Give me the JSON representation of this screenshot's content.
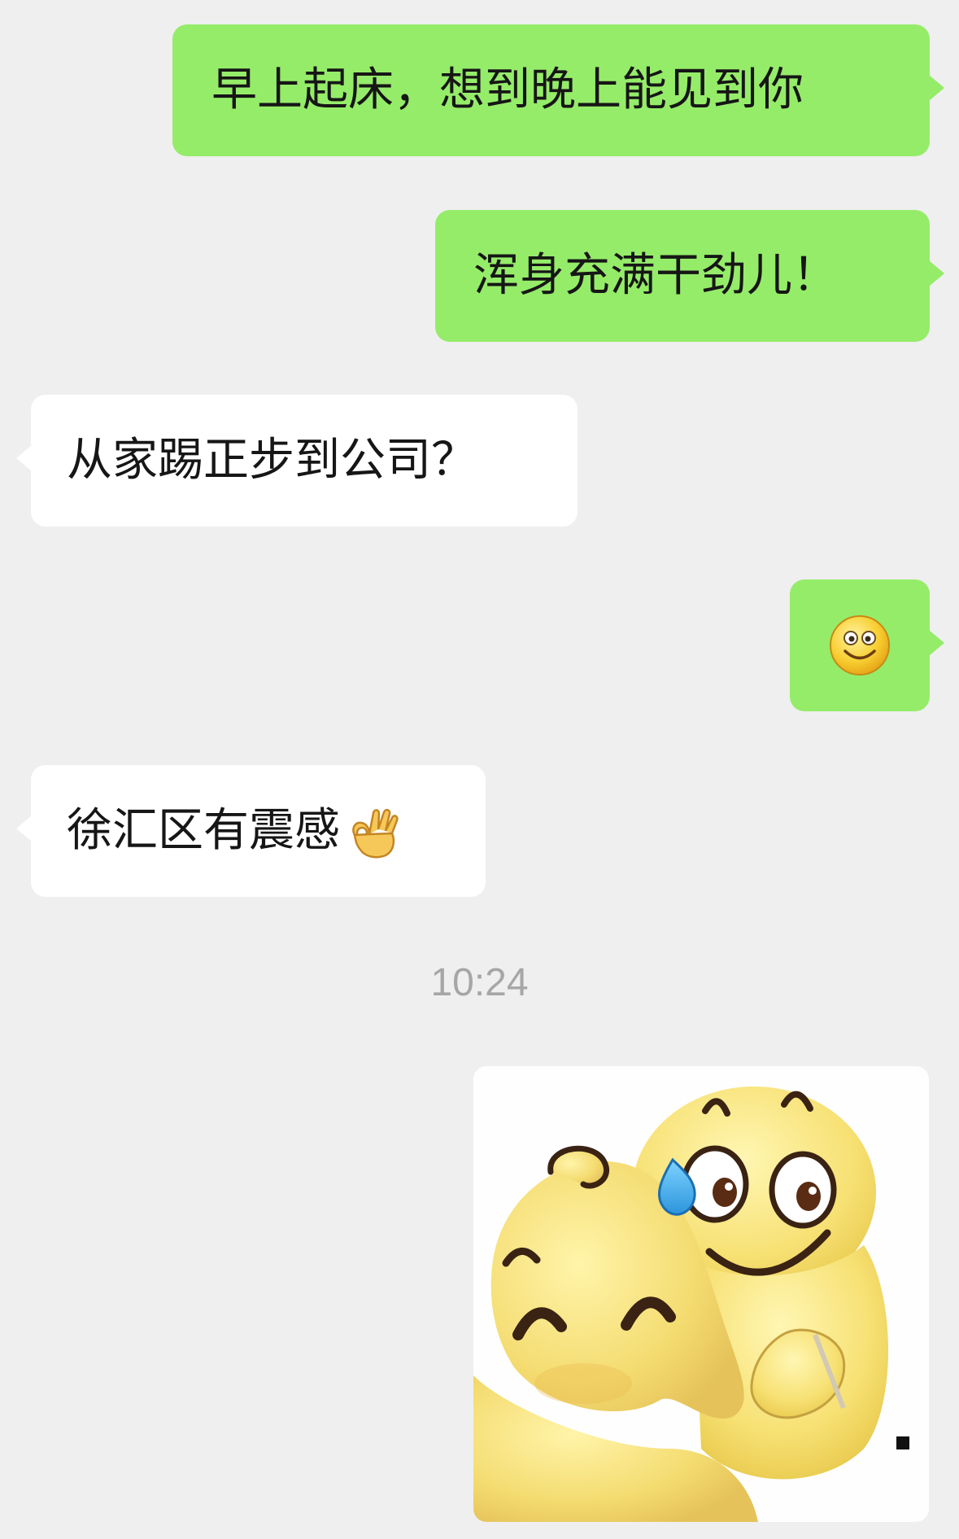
{
  "messages": [
    {
      "side": "sent",
      "text": "早上起床，想到晚上能见到你"
    },
    {
      "side": "sent",
      "text": "浑身充满干劲儿！"
    },
    {
      "side": "received",
      "text": "从家踢正步到公司？"
    },
    {
      "side": "sent",
      "emoji": "smile-emoji"
    },
    {
      "side": "received",
      "text": "徐汇区有震感",
      "emoji": "ok-hand-emoji"
    },
    {
      "side": "sent",
      "sticker": "hugging-emoji-sticker"
    }
  ],
  "timestamp": "10:24",
  "colors": {
    "background": "#efefef",
    "sent_bubble": "#95ec69",
    "received_bubble": "#ffffff",
    "timestamp_text": "#a6a6a6"
  }
}
